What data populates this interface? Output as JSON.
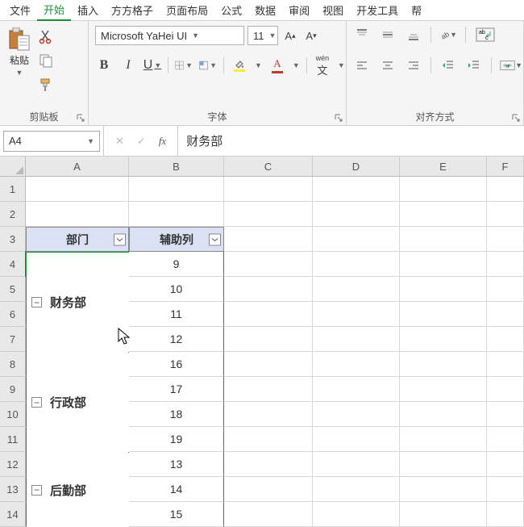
{
  "menu": {
    "items": [
      "文件",
      "开始",
      "插入",
      "方方格子",
      "页面布局",
      "公式",
      "数据",
      "审阅",
      "视图",
      "开发工具",
      "帮"
    ],
    "active": 1
  },
  "ribbon": {
    "clipboard": {
      "paste": "粘贴",
      "label": "剪贴板"
    },
    "font": {
      "name": "Microsoft YaHei UI",
      "size": "11",
      "b": "B",
      "i": "I",
      "u": "U",
      "wen": "wén",
      "label": "字体"
    },
    "align": {
      "ab": "ab",
      "label": "对齐方式"
    }
  },
  "cellref": "A4",
  "formula": "财务部",
  "cols": [
    "A",
    "B",
    "C",
    "D",
    "E",
    "F"
  ],
  "rows": [
    "1",
    "2",
    "3",
    "4",
    "5",
    "6",
    "7",
    "8",
    "9",
    "10",
    "11",
    "12",
    "13",
    "14"
  ],
  "table": {
    "headers": {
      "A": "部门",
      "B": "辅助列"
    },
    "groups": [
      {
        "name": "财务部",
        "rows": [
          4,
          5,
          6,
          7
        ]
      },
      {
        "name": "行政部",
        "rows": [
          8,
          9,
          10,
          11
        ]
      },
      {
        "name": "后勤部",
        "rows": [
          12,
          13,
          14
        ]
      }
    ],
    "bvals": {
      "4": "9",
      "5": "10",
      "6": "11",
      "7": "12",
      "8": "16",
      "9": "17",
      "10": "18",
      "11": "19",
      "12": "13",
      "13": "14",
      "14": "15"
    }
  },
  "collapse_glyph": "−"
}
